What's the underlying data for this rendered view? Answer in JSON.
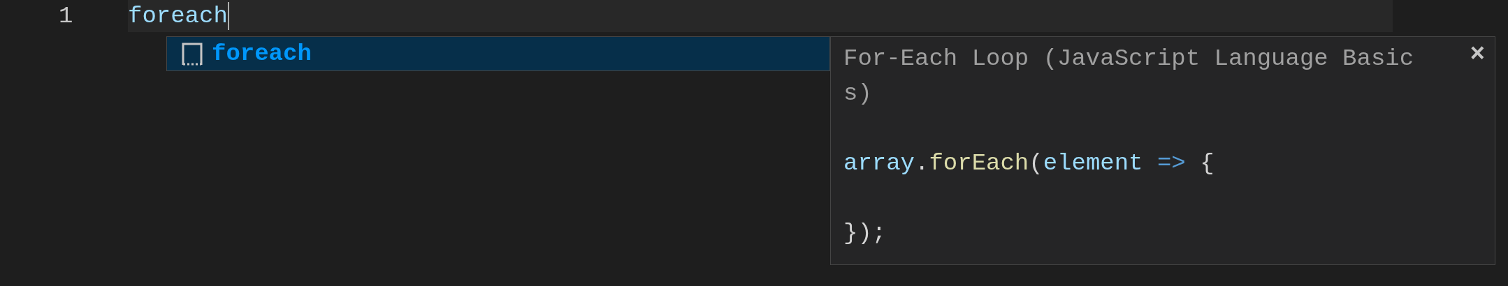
{
  "editor": {
    "line_number": "1",
    "line_text": "foreach"
  },
  "suggestions": [
    {
      "label": "foreach",
      "selected": true
    }
  ],
  "details": {
    "title": "For-Each Loop (JavaScript Language Basics)",
    "close": "×",
    "code": [
      {
        "kind": "code",
        "tokens": [
          {
            "kind": "variable",
            "text": "array"
          },
          {
            "kind": "punct",
            "text": "."
          },
          {
            "kind": "function",
            "text": "forEach"
          },
          {
            "kind": "punct",
            "text": "("
          },
          {
            "kind": "variable",
            "text": "element"
          },
          {
            "kind": "operator",
            "text": " => "
          },
          {
            "kind": "punct",
            "text": "{"
          }
        ]
      },
      {
        "kind": "blank"
      },
      {
        "kind": "code",
        "tokens": [
          {
            "kind": "punct",
            "text": "});"
          }
        ]
      }
    ]
  }
}
